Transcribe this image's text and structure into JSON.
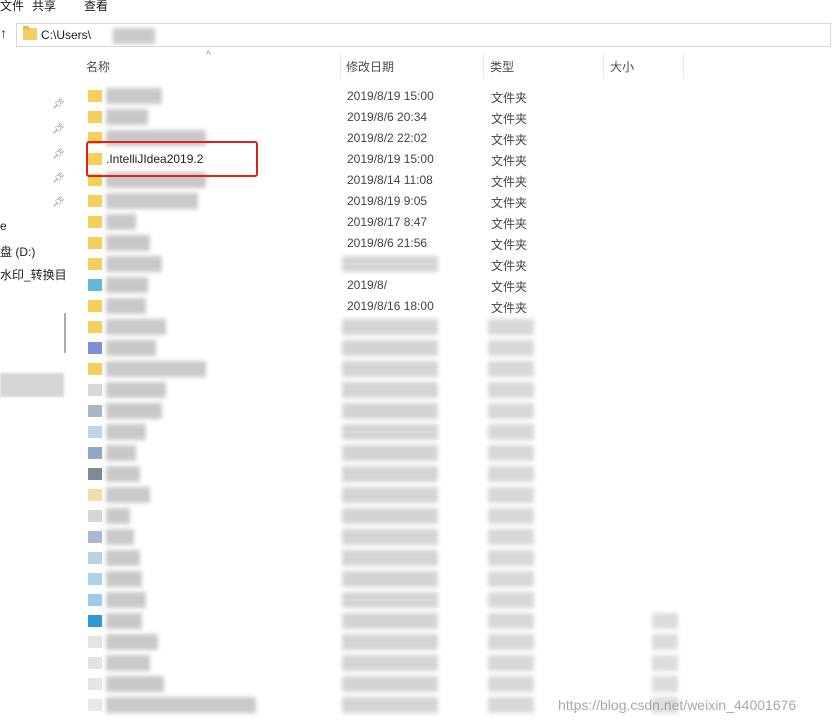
{
  "ribbon": {
    "tabs": [
      "文件",
      "共享",
      "查看"
    ]
  },
  "address": {
    "path": "C:\\Users\\"
  },
  "nav": {
    "item_e": "e",
    "drive": "盘 (D:)",
    "folder": "水印_转换目"
  },
  "columns": {
    "name": "名称",
    "date": "修改日期",
    "type": "类型",
    "size": "大小"
  },
  "rows": [
    {
      "name": "",
      "date": "2019/8/19 15:00",
      "type": "文件夹"
    },
    {
      "name": "",
      "date": "2019/8/6 20:34",
      "type": "文件夹"
    },
    {
      "name": "",
      "date": "2019/8/2 22:02",
      "type": "文件夹"
    },
    {
      "name": ".IntelliJIdea2019.2",
      "date": "2019/8/19 15:00",
      "type": "文件夹"
    },
    {
      "name": "",
      "date": "2019/8/14 11:08",
      "type": "文件夹"
    },
    {
      "name": "",
      "date": "2019/8/19 9:05",
      "type": "文件夹"
    },
    {
      "name": "",
      "date": "2019/8/17 8:47",
      "type": "文件夹"
    },
    {
      "name": "",
      "date": "2019/8/6 21:56",
      "type": "文件夹"
    },
    {
      "name": "",
      "date": "",
      "type": "文件夹"
    },
    {
      "name": "",
      "date": "2019/8/",
      "type": "文件夹"
    },
    {
      "name": "",
      "date": "2019/8/16 18:00",
      "type": "文件夹"
    }
  ],
  "watermark": "https://blog.csdn.net/weixin_44001676"
}
